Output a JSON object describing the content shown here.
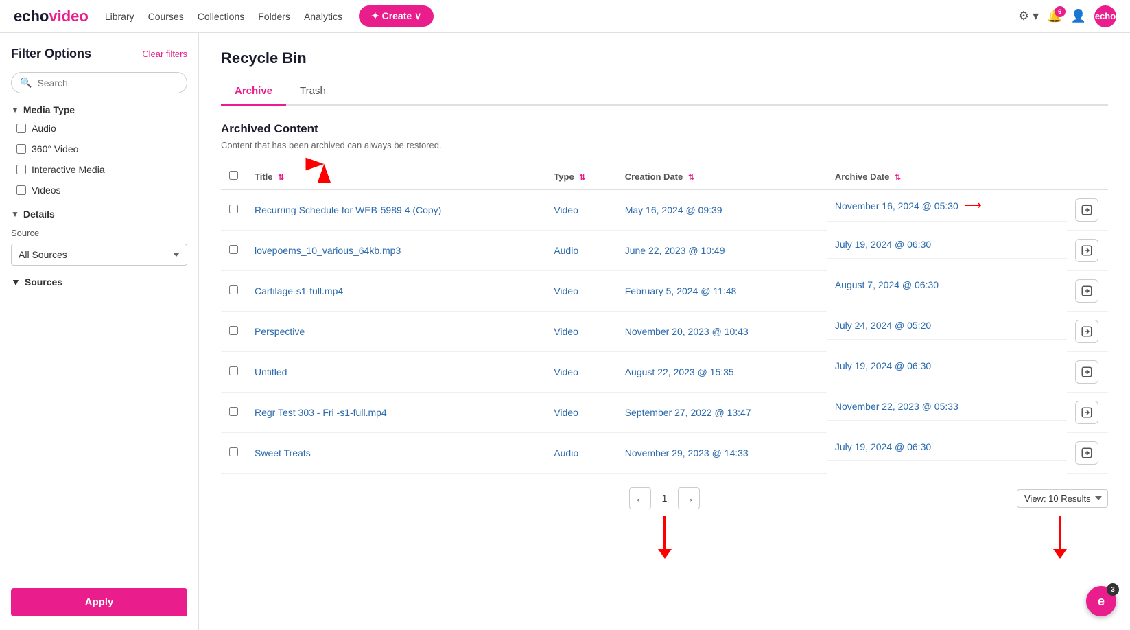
{
  "nav": {
    "logo_echo": "echo",
    "logo_video": "video",
    "links": [
      "Library",
      "Courses",
      "Collections",
      "Folders",
      "Analytics"
    ],
    "create_label": "✦ Create ∨",
    "notification_count": "6"
  },
  "sidebar": {
    "title": "Filter Options",
    "clear_filters_label": "Clear filters",
    "search_placeholder": "Search",
    "media_type_label": "Media Type",
    "media_types": [
      "Audio",
      "360° Video",
      "Interactive Media",
      "Videos"
    ],
    "details_label": "Details",
    "source_label": "Source",
    "sources_label": "Sources",
    "all_sources_option": "All Sources",
    "apply_label": "Apply"
  },
  "main": {
    "page_title": "Recycle Bin",
    "tabs": [
      "Archive",
      "Trash"
    ],
    "active_tab": "Archive",
    "archived_title": "Archived Content",
    "archived_subtitle": "Content that has been archived can always be restored.",
    "columns": {
      "title": "Title",
      "type": "Type",
      "creation_date": "Creation Date",
      "archive_date": "Archive Date"
    },
    "rows": [
      {
        "title": "Recurring Schedule for WEB-5989 4 (Copy)",
        "type": "Video",
        "creation_date": "May 16, 2024 @ 09:39",
        "archive_date": "November 16, 2024 @ 05:30",
        "has_arrow": true
      },
      {
        "title": "lovepoems_10_various_64kb.mp3",
        "type": "Audio",
        "creation_date": "June 22, 2023 @ 10:49",
        "archive_date": "July 19, 2024 @ 06:30",
        "has_arrow": false
      },
      {
        "title": "Cartilage-s1-full.mp4",
        "type": "Video",
        "creation_date": "February 5, 2024 @ 11:48",
        "archive_date": "August 7, 2024 @ 06:30",
        "has_arrow": false
      },
      {
        "title": "Perspective",
        "type": "Video",
        "creation_date": "November 20, 2023 @ 10:43",
        "archive_date": "July 24, 2024 @ 05:20",
        "has_arrow": false
      },
      {
        "title": "Untitled",
        "type": "Video",
        "creation_date": "August 22, 2023 @ 15:35",
        "archive_date": "July 19, 2024 @ 06:30",
        "has_arrow": false
      },
      {
        "title": "Regr Test 303 - Fri -s1-full.mp4",
        "type": "Video",
        "creation_date": "September 27, 2022 @ 13:47",
        "archive_date": "November 22, 2023 @ 05:33",
        "has_arrow": false
      },
      {
        "title": "Sweet Treats",
        "type": "Audio",
        "creation_date": "November 29, 2023 @ 14:33",
        "archive_date": "July 19, 2024 @ 06:30",
        "has_arrow": false
      }
    ],
    "pagination": {
      "current_page": "1",
      "prev_label": "←",
      "next_label": "→",
      "view_label": "View: 10 Results"
    }
  },
  "echo_badge": {
    "letter": "e",
    "count": "3"
  }
}
